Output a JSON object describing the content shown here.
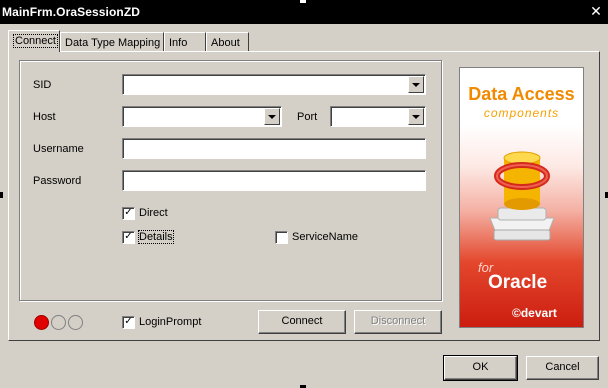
{
  "window": {
    "title": "MainFrm.OraSessionZD",
    "close_glyph": "✕"
  },
  "tabs": [
    {
      "label": "Connect",
      "active": true
    },
    {
      "label": "Data Type Mapping",
      "active": false
    },
    {
      "label": "Info",
      "active": false
    },
    {
      "label": "About",
      "active": false
    }
  ],
  "form": {
    "sid_label": "SID",
    "sid_value": "",
    "host_label": "Host",
    "host_value": "",
    "port_label": "Port",
    "port_value": "",
    "username_label": "Username",
    "username_value": "",
    "password_label": "Password",
    "password_value": "",
    "direct_label": "Direct",
    "direct_checked": true,
    "details_label": "Details",
    "details_checked": true,
    "servicename_label": "ServiceName",
    "servicename_checked": false,
    "loginprompt_label": "LoginPrompt",
    "loginprompt_checked": true,
    "check_glyph": "✓"
  },
  "status_leds": [
    {
      "state": "on",
      "color": "#e00000"
    },
    {
      "state": "off"
    },
    {
      "state": "off"
    }
  ],
  "buttons": {
    "connect": "Connect",
    "disconnect": "Disconnect",
    "ok": "OK",
    "cancel": "Cancel"
  },
  "banner": {
    "title": "Data Access",
    "subtitle": "components",
    "for_text": "for",
    "product": "Oracle",
    "brand": "©devart",
    "accent_color": "#f28a00",
    "bottom_color": "#cc1d10",
    "icon": "database-cylinder-icon"
  }
}
